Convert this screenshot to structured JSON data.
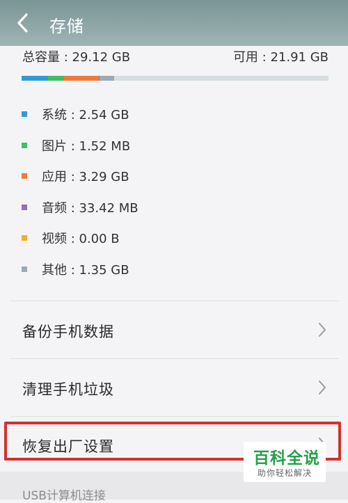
{
  "header": {
    "title": "存储",
    "back_icon": "back-arrow-icon"
  },
  "summary": {
    "total_label": "总容量 : 29.12 GB",
    "available_label": "可用 : 21.91 GB"
  },
  "usage_bar": {
    "total_gb": 29.12,
    "segments": [
      {
        "name": "系统",
        "gb": 2.54,
        "color": "#2f9bd6"
      },
      {
        "name": "图片",
        "gb": 1.52,
        "color": "#3fbf62"
      },
      {
        "name": "应用",
        "gb": 3.29,
        "color": "#ee7a3a"
      },
      {
        "name": "音频",
        "gb": 0.03342,
        "color": "#9b6ab8"
      },
      {
        "name": "视频",
        "gb": 0.0,
        "color": "#f0b02a"
      },
      {
        "name": "其他",
        "gb": 1.35,
        "color": "#9aabb3"
      }
    ],
    "free_color": "#d7dde0"
  },
  "legend": [
    {
      "text": "系统 : 2.54 GB",
      "color": "#2f9bd6"
    },
    {
      "text": "图片 : 1.52 MB",
      "color": "#3fbf62"
    },
    {
      "text": "应用 : 3.29 GB",
      "color": "#ee7a3a"
    },
    {
      "text": "音频 : 33.42 MB",
      "color": "#9b6ab8"
    },
    {
      "text": "视频 : 0.00 B",
      "color": "#f0b02a"
    },
    {
      "text": "其他 : 1.35 GB",
      "color": "#9aabb3"
    }
  ],
  "menu": [
    {
      "label": "备份手机数据"
    },
    {
      "label": "清理手机垃圾"
    },
    {
      "label": "恢复出厂设置"
    }
  ],
  "section": {
    "label": "USB计算机连接"
  },
  "watermark": {
    "title": "百科全说",
    "subtitle": "助你轻松解决"
  },
  "colors": {
    "highlight": "#d0322e",
    "header": "#8aa3a4"
  }
}
